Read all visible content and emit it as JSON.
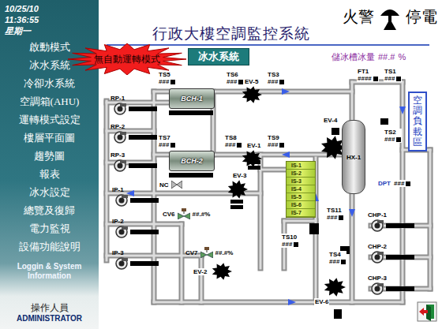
{
  "sidebar": {
    "date": "10/25/10",
    "time": "11:36:55",
    "weekday": "星期一",
    "items": [
      {
        "label": "啟動模式"
      },
      {
        "label": "冰水系統"
      },
      {
        "label": "冷卻水系統"
      },
      {
        "label": "空調箱(AHU)"
      },
      {
        "label": "運轉模式設定"
      },
      {
        "label": "樓層平面圖"
      },
      {
        "label": "趨勢圖"
      },
      {
        "label": "報表"
      },
      {
        "label": "冰水設定"
      },
      {
        "label": "總覽及復歸"
      },
      {
        "label": "電力監視"
      },
      {
        "label": "設備功能說明"
      }
    ],
    "info": "Loggin & System Information",
    "operator_label": "操作人員",
    "operator": "ADMINISTRATOR"
  },
  "header": {
    "title": "行政大樓空調監控系統",
    "alarms": [
      {
        "label": "火警"
      },
      {
        "label": "停電"
      }
    ],
    "banner": "無自動運轉模式",
    "section": "冰水系統",
    "ice_level": {
      "label": "儲冰槽冰量",
      "value": "##.#",
      "unit": "%"
    }
  },
  "diagram": {
    "sensors": [
      {
        "label": "TS5",
        "value": "###"
      },
      {
        "label": "TS6",
        "value": "###"
      },
      {
        "label": "TS3",
        "value": "###"
      },
      {
        "label": "FT1",
        "value": "####"
      },
      {
        "label": "TS1",
        "value": "###"
      },
      {
        "label": "TS7",
        "value": "###"
      },
      {
        "label": "TS8",
        "value": "###"
      },
      {
        "label": "TS9",
        "value": "###"
      },
      {
        "label": "TS2",
        "value": "###"
      },
      {
        "label": "DPT",
        "value": "###"
      },
      {
        "label": "TS11",
        "value": "###"
      },
      {
        "label": "TS10",
        "value": "###"
      },
      {
        "label": "TS4",
        "value": "###"
      }
    ],
    "pumps": [
      {
        "label": "RP-1"
      },
      {
        "label": "RP-2"
      },
      {
        "label": "RP-3"
      },
      {
        "label": "IP-1"
      },
      {
        "label": "IP-2"
      },
      {
        "label": "IP-3"
      },
      {
        "label": "CHP-1"
      },
      {
        "label": "CHP-2"
      },
      {
        "label": "CHP-3"
      }
    ],
    "chillers": [
      {
        "label": "BCH-1"
      },
      {
        "label": "BCH-2"
      }
    ],
    "valves": [
      {
        "label": "EV-5"
      },
      {
        "label": "EV-1"
      },
      {
        "label": "EV-3"
      },
      {
        "label": "EV-4"
      },
      {
        "label": "EV-2"
      },
      {
        "label": "EV-6"
      }
    ],
    "control_valves": [
      {
        "label": "CV6",
        "value": "##.#%"
      },
      {
        "label": "CV7",
        "value": "##.#%"
      }
    ],
    "nc": "NC",
    "tanks": [
      {
        "label": "IS-1"
      },
      {
        "label": "IS-2"
      },
      {
        "label": "IS-3"
      },
      {
        "label": "IS-4"
      },
      {
        "label": "IS-5"
      },
      {
        "label": "IS-6"
      },
      {
        "label": "IS-7"
      }
    ],
    "exchanger": "HX-1",
    "load_zone": "空調負載區"
  }
}
